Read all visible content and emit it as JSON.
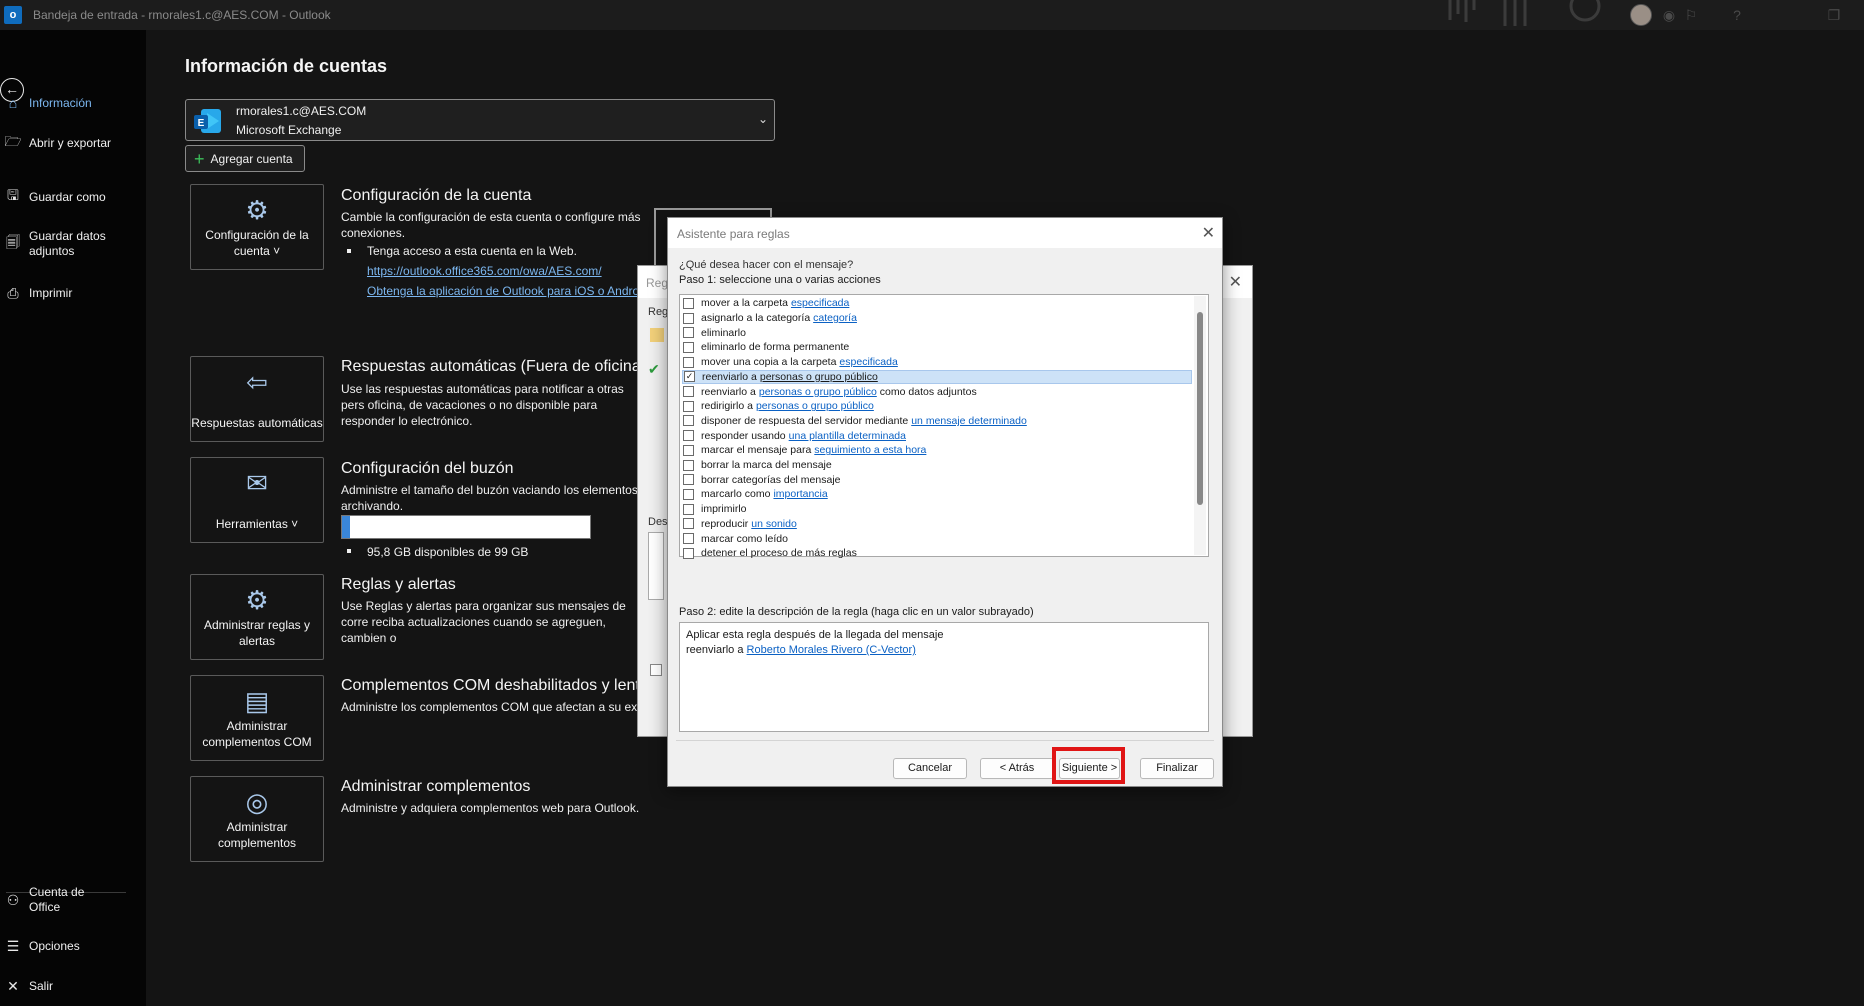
{
  "titlebar": {
    "title": "Bandeja de entrada - rmorales1.c@AES.COM  -  Outlook",
    "logo_letter": "o"
  },
  "nav": {
    "items": [
      {
        "label": "Información",
        "icon": "home-icon"
      },
      {
        "label": "Abrir y exportar",
        "icon": "folder-open-icon"
      },
      {
        "label": "Guardar como",
        "icon": "save-as-icon"
      },
      {
        "label": "Guardar datos adjuntos",
        "icon": "save-attachments-icon"
      },
      {
        "label": "Imprimir",
        "icon": "printer-icon"
      }
    ],
    "bottom": [
      {
        "label": "Cuenta de Office",
        "icon": "person-icon"
      },
      {
        "label": "Opciones",
        "icon": "options-icon"
      },
      {
        "label": "Salir",
        "icon": "close-icon"
      }
    ]
  },
  "main": {
    "title": "Información de cuentas",
    "account": {
      "email": "rmorales1.c@AES.COM",
      "type": "Microsoft Exchange"
    },
    "add_account": "Agregar cuenta",
    "tiles": [
      {
        "label": "Configuración de la cuenta ˅",
        "icon": "account-settings-icon"
      },
      {
        "label": "Respuestas automáticas",
        "icon": "auto-reply-icon"
      },
      {
        "label": "Herramientas ˅",
        "icon": "tools-icon"
      },
      {
        "label": "Administrar reglas y alertas",
        "icon": "rules-icon"
      },
      {
        "label": "Administrar complementos COM",
        "icon": "com-addins-icon"
      },
      {
        "label": "Administrar complementos",
        "icon": "globe-icon"
      }
    ],
    "sections": {
      "account_settings": {
        "title": "Configuración de la cuenta",
        "text": "Cambie la configuración de esta cuenta o configure más conexiones.",
        "bullet": "Tenga acceso a esta cuenta en la Web.",
        "link1": "https://outlook.office365.com/owa/AES.com/",
        "link2": "Obtenga la aplicación de Outlook para iOS o Andro"
      },
      "auto_replies": {
        "title": "Respuestas automáticas (Fuera de oficina)",
        "text": "Use las respuestas automáticas para notificar a otras pers oficina, de vacaciones o no disponible para responder lo electrónico."
      },
      "mailbox": {
        "title": "Configuración del buzón",
        "text": "Administre el tamaño del buzón vaciando los elementos archivando.",
        "storage_text": "95,8 GB disponibles de 99 GB",
        "used_fraction": 0.032
      },
      "rules": {
        "title": "Reglas y alertas",
        "text": "Use Reglas y alertas para organizar sus mensajes de corre reciba actualizaciones cuando se agreguen, cambien o"
      },
      "com": {
        "title": "Complementos COM deshabilitados y lentos",
        "text": "Administre los complementos COM que afectan a su ex"
      },
      "addins": {
        "title": "Administrar complementos",
        "text": "Administre y adquiera complementos web para Outlook."
      }
    }
  },
  "bg_dialog": {
    "title": "Regl",
    "frag1": "Reg",
    "frag2": "Des"
  },
  "dialog": {
    "title": "Asistente para reglas",
    "question": "¿Qué desea hacer con el mensaje?",
    "step1": "Paso 1: seleccione una o varias acciones",
    "actions": [
      {
        "text": "mover a la carpeta",
        "link": "especificada",
        "after": "",
        "checked": false
      },
      {
        "text": "asignarlo a la categoría",
        "link": "categoría",
        "after": "",
        "checked": false
      },
      {
        "text": "eliminarlo",
        "link": "",
        "after": "",
        "checked": false
      },
      {
        "text": "eliminarlo de forma permanente",
        "link": "",
        "after": "",
        "checked": false
      },
      {
        "text": "mover una copia a la carpeta",
        "link": "especificada",
        "after": "",
        "checked": false
      },
      {
        "text": "reenviarlo a",
        "link": "personas o grupo público",
        "after": "",
        "checked": true
      },
      {
        "text": "reenviarlo a",
        "link": "personas o grupo público",
        "after": "como datos adjuntos",
        "checked": false
      },
      {
        "text": "redirigirlo a",
        "link": "personas o grupo público",
        "after": "",
        "checked": false
      },
      {
        "text": "disponer de respuesta del servidor mediante",
        "link": "un mensaje determinado",
        "after": "",
        "checked": false
      },
      {
        "text": "responder usando",
        "link": "una plantilla determinada",
        "after": "",
        "checked": false
      },
      {
        "text": "marcar el mensaje para",
        "link": "seguimiento a esta hora",
        "after": "",
        "checked": false
      },
      {
        "text": "borrar la marca del mensaje",
        "link": "",
        "after": "",
        "checked": false
      },
      {
        "text": "borrar categorías del mensaje",
        "link": "",
        "after": "",
        "checked": false
      },
      {
        "text": "marcarlo como",
        "link": "importancia",
        "after": "",
        "checked": false
      },
      {
        "text": "imprimirlo",
        "link": "",
        "after": "",
        "checked": false
      },
      {
        "text": "reproducir",
        "link": "un sonido",
        "after": "",
        "checked": false
      },
      {
        "text": "marcar como leído",
        "link": "",
        "after": "",
        "checked": false
      },
      {
        "text": "detener el proceso de más reglas",
        "link": "",
        "after": "",
        "checked": false
      }
    ],
    "step2": "Paso 2: edite la descripción de la regla (haga clic en un valor subrayado)",
    "desc_line1": "Aplicar esta regla después de la llegada del mensaje",
    "desc_line2_prefix": "reenviarlo a",
    "desc_line2_link": "Roberto Morales Rivero (C-Vector)",
    "buttons": {
      "cancel": "Cancelar",
      "back": "< Atrás",
      "next": "Siguiente >",
      "finish": "Finalizar"
    }
  },
  "colors": {
    "accent": "#7cb7f0",
    "highlight": "#e01515",
    "link": "#0b61c4"
  }
}
